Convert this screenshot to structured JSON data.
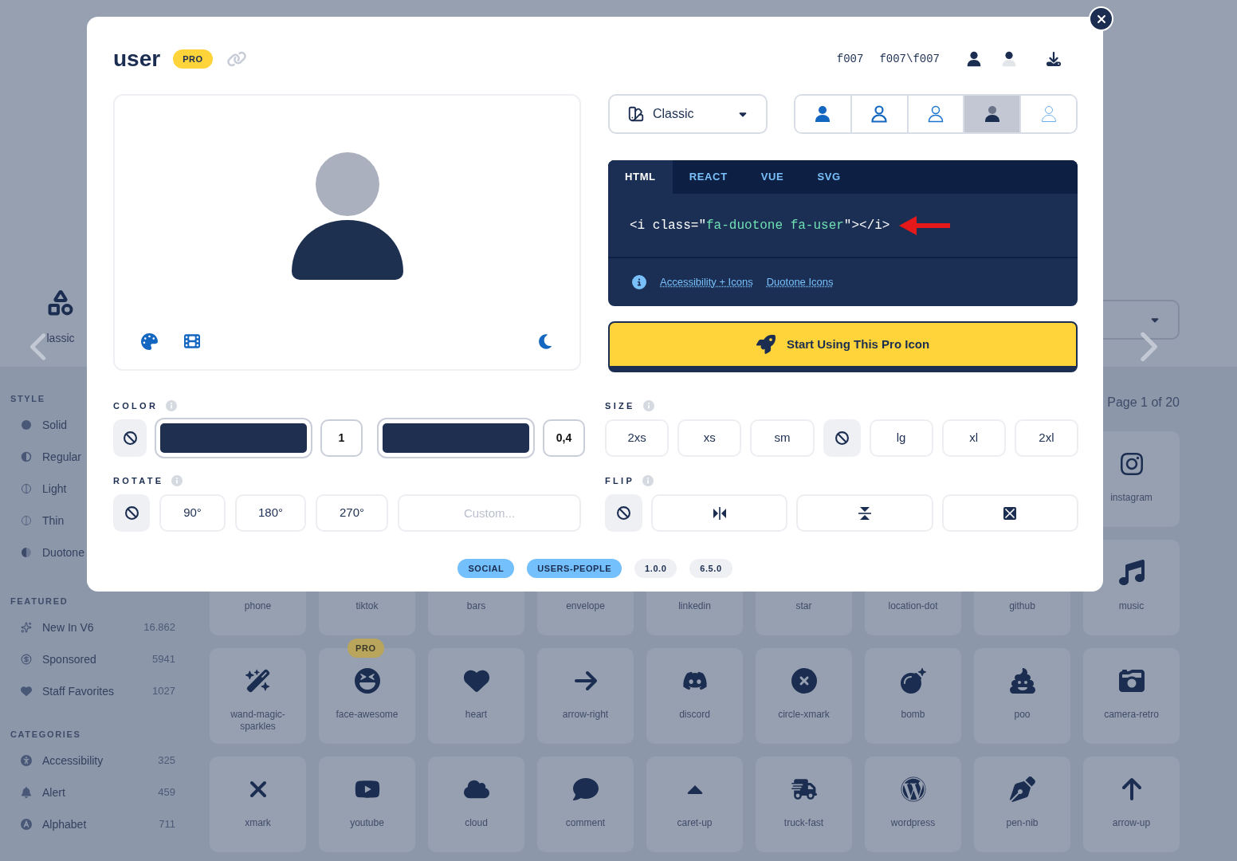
{
  "background": {
    "style_picker": {
      "label": "lassic"
    },
    "pagination": "Page 1 of 20",
    "sidebar": [
      {
        "title": "STYLE",
        "items": [
          {
            "label": "Solid",
            "kind": "solid"
          },
          {
            "label": "Regular",
            "kind": "regular"
          },
          {
            "label": "Light",
            "kind": "light"
          },
          {
            "label": "Thin",
            "kind": "thin"
          },
          {
            "label": "Duotone",
            "kind": "duotone"
          }
        ]
      },
      {
        "title": "FEATURED",
        "items": [
          {
            "label": "New In V6",
            "count": "16.862"
          },
          {
            "label": "Sponsored",
            "count": "5941"
          },
          {
            "label": "Staff Favorites",
            "count": "1027"
          }
        ]
      },
      {
        "title": "CATEGORIES",
        "items": [
          {
            "label": "Accessibility",
            "count": "325"
          },
          {
            "label": "Alert",
            "count": "459"
          },
          {
            "label": "Alphabet",
            "count": "711"
          }
        ]
      }
    ],
    "grid": [
      [
        {
          "label": "instagram"
        }
      ],
      [
        {
          "label": "phone"
        },
        {
          "label": "tiktok"
        },
        {
          "label": "bars"
        },
        {
          "label": "envelope"
        },
        {
          "label": "linkedin"
        },
        {
          "label": "star"
        },
        {
          "label": "location-dot"
        },
        {
          "label": "github"
        },
        {
          "label": "music"
        }
      ],
      [
        {
          "label": "wand-magic-sparkles"
        },
        {
          "label": "face-awesome",
          "badge": "PRO"
        },
        {
          "label": "heart"
        },
        {
          "label": "arrow-right"
        },
        {
          "label": "discord"
        },
        {
          "label": "circle-xmark"
        },
        {
          "label": "bomb"
        },
        {
          "label": "poo"
        },
        {
          "label": "camera-retro"
        }
      ],
      [
        {
          "label": "xmark"
        },
        {
          "label": "youtube"
        },
        {
          "label": "cloud"
        },
        {
          "label": "comment"
        },
        {
          "label": "caret-up"
        },
        {
          "label": "truck-fast"
        },
        {
          "label": "wordpress"
        },
        {
          "label": "pen-nib"
        },
        {
          "label": "arrow-up"
        }
      ]
    ]
  },
  "modal": {
    "title": "user",
    "badge": "PRO",
    "unicode": "f007",
    "unicode_duotone": "f007\\f007",
    "family_select": {
      "value": "Classic"
    },
    "styles": [
      {
        "kind": "solid",
        "selected": false
      },
      {
        "kind": "regular",
        "selected": false
      },
      {
        "kind": "light",
        "selected": false
      },
      {
        "kind": "duotone",
        "selected": true
      },
      {
        "kind": "thin",
        "selected": false
      }
    ],
    "code": {
      "tabs": [
        {
          "label": "HTML",
          "selected": true
        },
        {
          "label": "REACT",
          "selected": false
        },
        {
          "label": "VUE",
          "selected": false
        },
        {
          "label": "SVG",
          "selected": false
        }
      ],
      "parts": [
        {
          "text": "<i class=\"",
          "kind": "plain"
        },
        {
          "text": "fa-duotone fa-user",
          "kind": "string"
        },
        {
          "text": "\"></i>",
          "kind": "plain"
        }
      ],
      "links": [
        "Accessibility + Icons",
        "Duotone Icons"
      ]
    },
    "cta": "Start Using This Pro Icon",
    "color": {
      "label": "COLOR",
      "primary": {
        "color": "#1e2f50"
      },
      "primary_opacity": "1",
      "secondary": {
        "color": "#1e2f50"
      },
      "secondary_opacity": "0,4"
    },
    "size": {
      "label": "SIZE",
      "options": [
        {
          "label": "2xs",
          "kind": "text",
          "selected": false
        },
        {
          "label": "xs",
          "kind": "text",
          "selected": false
        },
        {
          "label": "sm",
          "kind": "text",
          "selected": false
        },
        {
          "kind": "none",
          "selected": true
        },
        {
          "label": "lg",
          "kind": "text",
          "selected": false
        },
        {
          "label": "xl",
          "kind": "text",
          "selected": false
        },
        {
          "label": "2xl",
          "kind": "text",
          "selected": false
        }
      ]
    },
    "rotate": {
      "label": "ROTATE",
      "options": [
        {
          "kind": "none",
          "selected": true
        },
        {
          "label": "90°",
          "kind": "text",
          "selected": false
        },
        {
          "label": "180°",
          "kind": "text",
          "selected": false
        },
        {
          "label": "270°",
          "kind": "text",
          "selected": false
        }
      ],
      "custom_placeholder": "Custom..."
    },
    "flip": {
      "label": "FLIP",
      "options": [
        {
          "kind": "none",
          "selected": true
        },
        {
          "kind": "horizontal",
          "selected": false
        },
        {
          "kind": "vertical",
          "selected": false
        },
        {
          "kind": "both",
          "selected": false
        }
      ]
    },
    "tags": [
      {
        "label": "SOCIAL",
        "kind": "category"
      },
      {
        "label": "USERS-PEOPLE",
        "kind": "category"
      },
      {
        "label": "1.0.0",
        "kind": "version"
      },
      {
        "label": "6.5.0",
        "kind": "version"
      }
    ]
  }
}
